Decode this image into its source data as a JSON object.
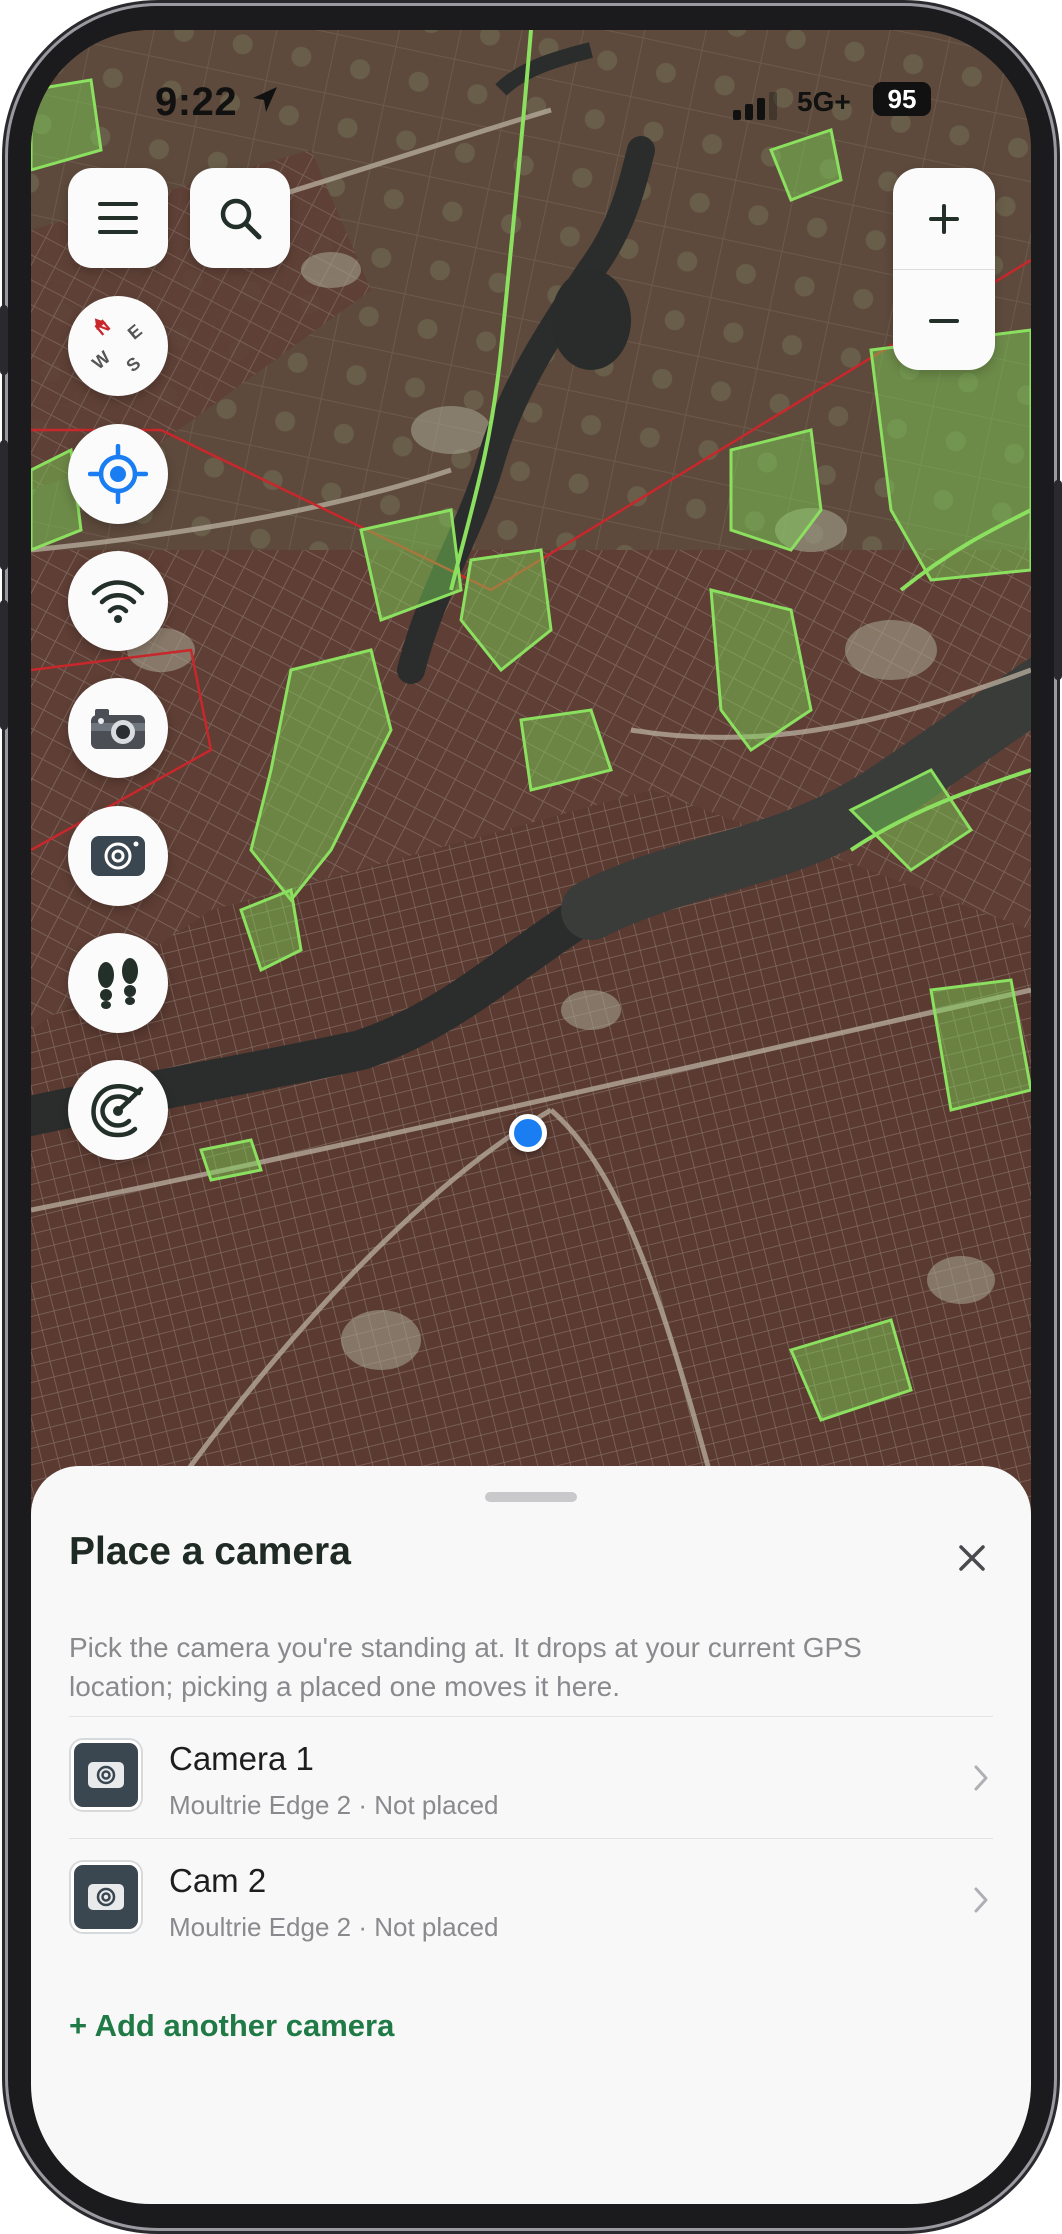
{
  "status_bar": {
    "time": "9:22",
    "network": "5G+",
    "battery": "95",
    "icons": [
      "location-arrow-icon",
      "signal-bars-icon"
    ]
  },
  "map_controls": {
    "top_left": [
      {
        "name": "menu-button",
        "icon": "hamburger-menu-icon"
      },
      {
        "name": "search-button",
        "icon": "magnifier-icon"
      }
    ],
    "zoom": {
      "in_label": "+",
      "out_label": "−"
    },
    "left_column": [
      {
        "name": "compass-button",
        "icon": "compass-icon",
        "letters": [
          "N",
          "E",
          "S",
          "W"
        ]
      },
      {
        "name": "locate-me-button",
        "icon": "crosshair-icon"
      },
      {
        "name": "wifi-button",
        "icon": "wifi-icon"
      },
      {
        "name": "trail-camera-button",
        "icon": "trail-camera-icon"
      },
      {
        "name": "camera-placement-button",
        "icon": "camera-icon"
      },
      {
        "name": "tracks-button",
        "icon": "footprints-icon"
      },
      {
        "name": "radar-button",
        "icon": "radar-icon"
      }
    ]
  },
  "colors": {
    "accent_green": "#1f7a46",
    "gps_blue": "#1a7ef2",
    "map_base": "#5e3e35",
    "parcel_green": "#7ed957",
    "boundary_red": "#c8272b"
  },
  "sheet": {
    "title": "Place a camera",
    "description": "Pick the camera you're standing at. It drops at your current GPS location; picking a placed one moves it here.",
    "cameras": [
      {
        "name": "Camera 1",
        "meta": "Moultrie Edge 2 · Not placed"
      },
      {
        "name": "Cam 2",
        "meta": "Moultrie Edge 2 · Not placed"
      }
    ],
    "add_label": "+ Add another camera"
  }
}
